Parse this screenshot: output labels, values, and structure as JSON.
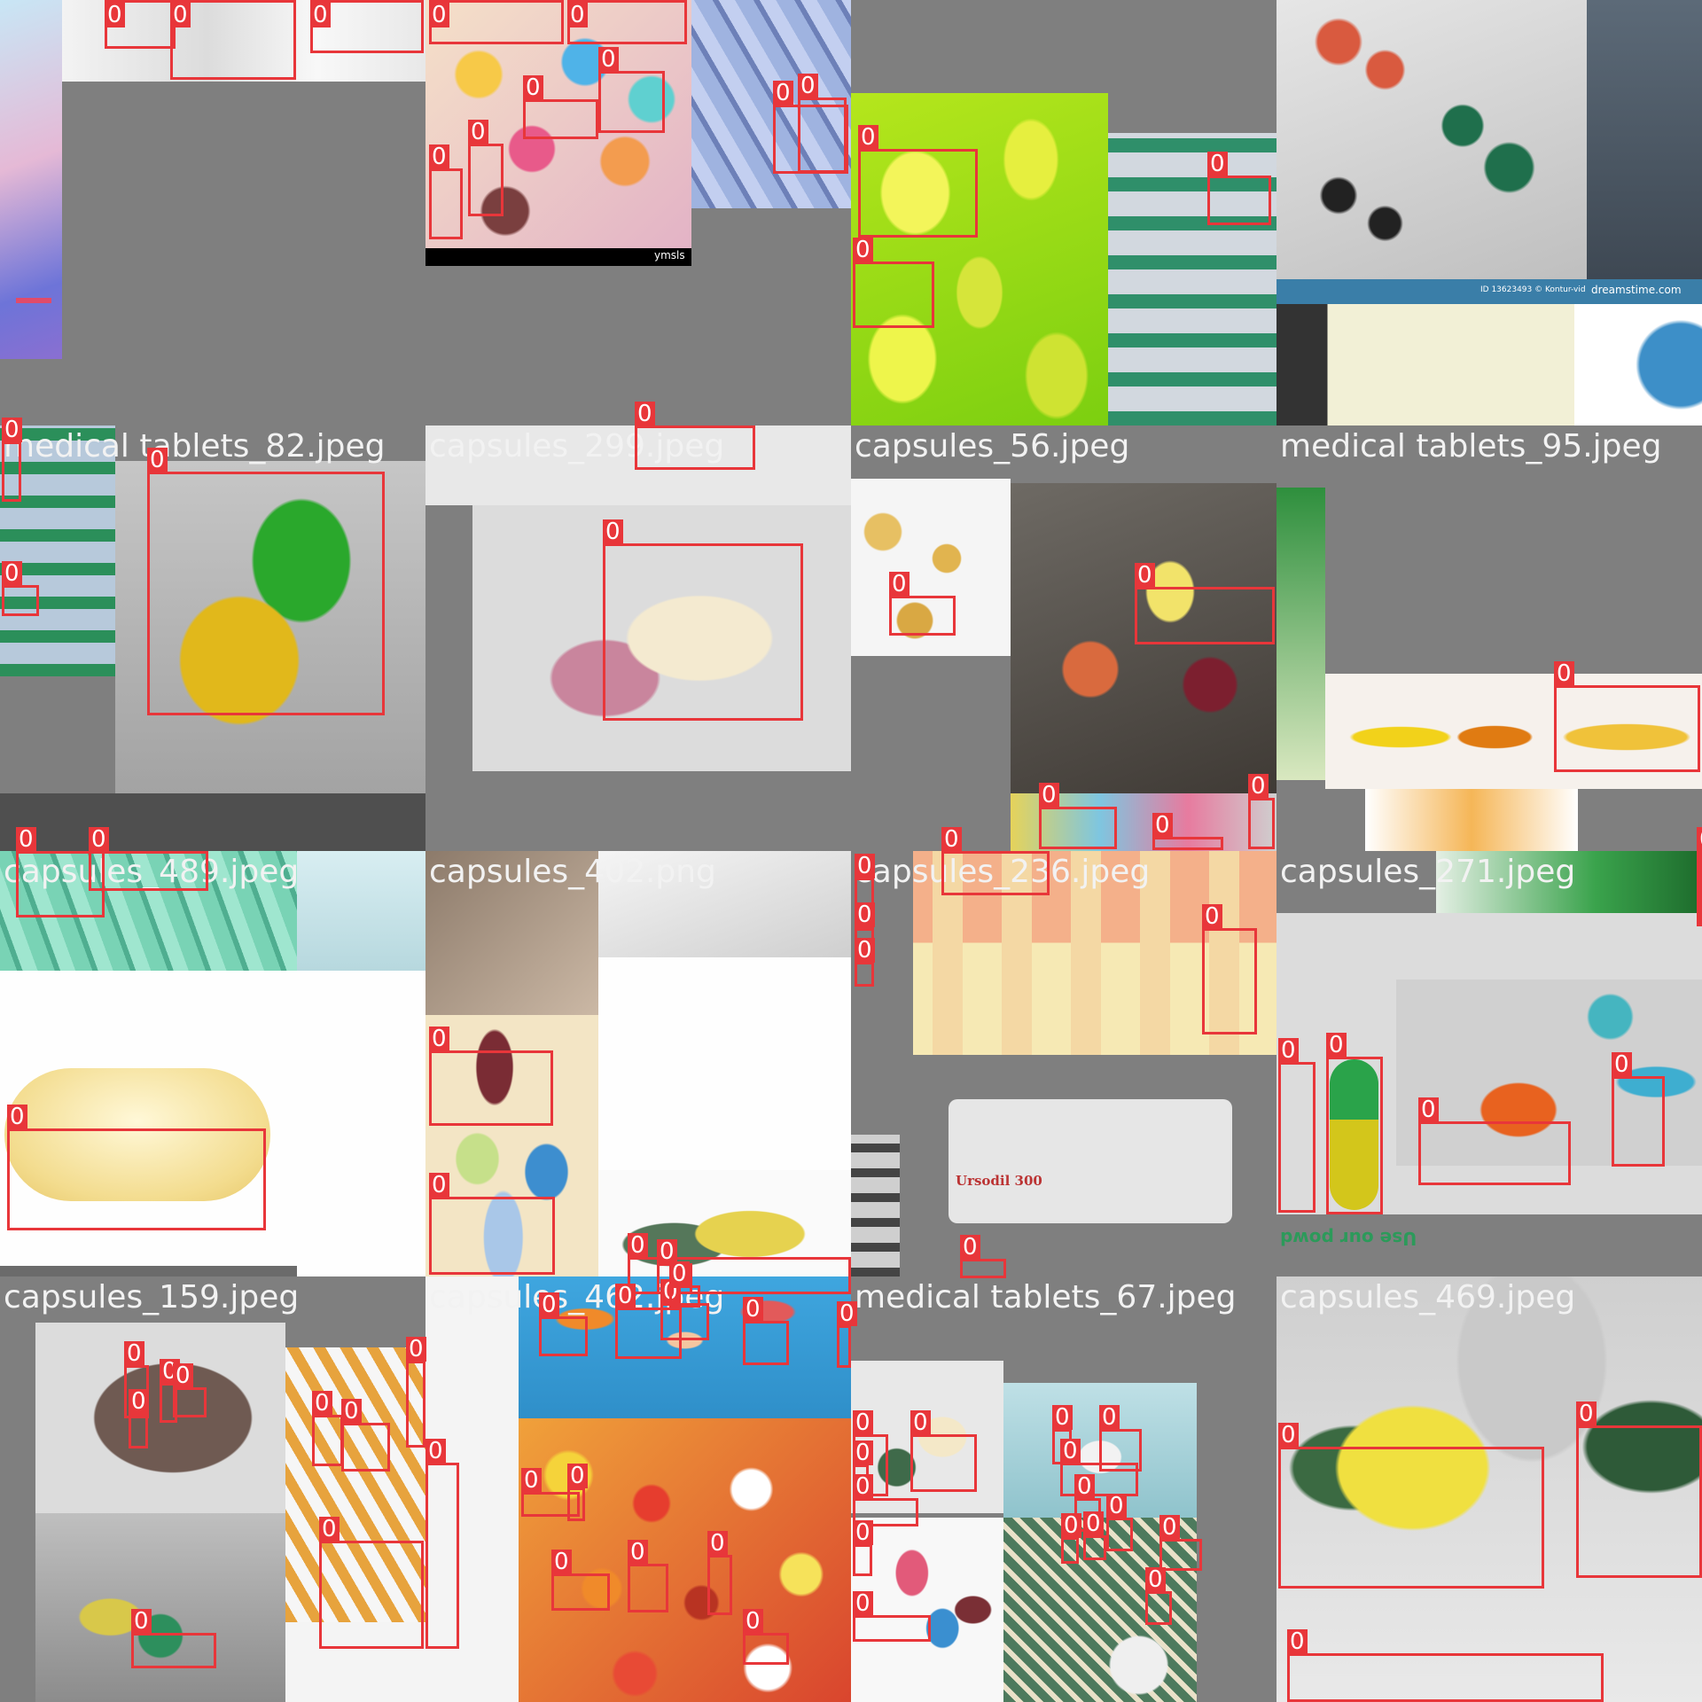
{
  "tiles": [
    {
      "caption": "",
      "labels": [
        "0",
        "0",
        "0",
        "0",
        "0",
        "0",
        "0",
        "0",
        "0",
        "0",
        "0",
        "0",
        "0",
        "0"
      ]
    },
    {
      "caption": "",
      "labels": [
        "0",
        "0",
        "0",
        "0"
      ]
    },
    {
      "caption": "",
      "labels": [
        "0",
        "0"
      ]
    },
    {
      "caption": "",
      "labels": []
    },
    {
      "caption": "medical tablets_82.jpeg",
      "labels": [
        "0",
        "0",
        "0"
      ]
    },
    {
      "caption": "capsules_299.jpeg",
      "labels": [
        "0",
        "0"
      ]
    },
    {
      "caption": "capsules_56.jpeg",
      "labels": [
        "0",
        "0",
        "0",
        "0",
        "0"
      ]
    },
    {
      "caption": "medical tablets_95.jpeg",
      "labels": [
        "0"
      ]
    },
    {
      "caption": "capsules_489.jpeg",
      "labels": [
        "0",
        "0",
        "0"
      ]
    },
    {
      "caption": "capsules_402.png",
      "labels": [
        "0",
        "0",
        "0",
        "0"
      ]
    },
    {
      "caption": "capsules_236.jpeg",
      "labels": [
        "0",
        "0",
        "0",
        "0",
        "0",
        "0"
      ]
    },
    {
      "caption": "capsules_271.jpeg",
      "labels": [
        "0",
        "0",
        "0",
        "0",
        "0",
        "0"
      ]
    },
    {
      "caption": "capsules_159.jpeg",
      "labels": [
        "0",
        "0",
        "0",
        "0",
        "0",
        "0",
        "0",
        "0",
        "0",
        "0"
      ]
    },
    {
      "caption": "capsules_462.jpeg",
      "labels": [
        "0",
        "0",
        "0",
        "0",
        "0",
        "0",
        "0",
        "0",
        "0",
        "0",
        "0",
        "0"
      ]
    },
    {
      "caption": "medical tablets_67.jpeg",
      "labels": [
        "0",
        "0",
        "0",
        "0",
        "0",
        "0",
        "0",
        "0",
        "0",
        "0",
        "0",
        "0",
        "0",
        "0",
        "0"
      ]
    },
    {
      "caption": "capsules_469.jpeg",
      "labels": [
        "0",
        "0",
        "0"
      ]
    }
  ],
  "photo_text": {
    "stock_id": "ID 13623493 © Kontur-vid",
    "stock_brand": "dreamstime.com",
    "watermark": "ymsls",
    "pack_text": "Ursodil 300",
    "promo_text": "Use our powd"
  }
}
